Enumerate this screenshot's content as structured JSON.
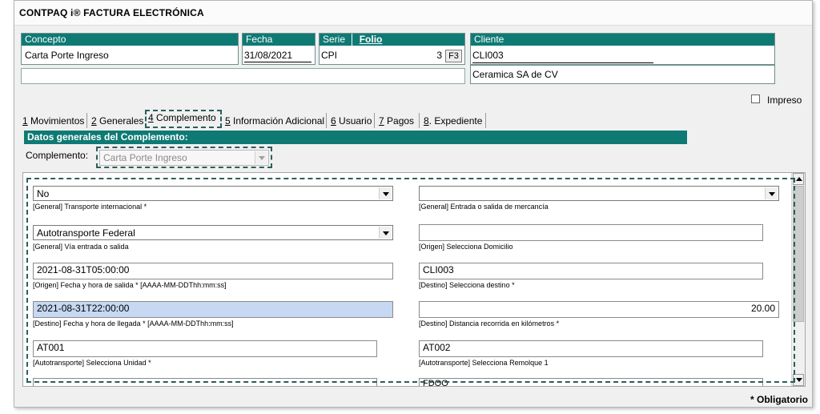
{
  "window": {
    "title": "CONTPAQ i® FACTURA ELECTRÓNICA"
  },
  "header": {
    "concepto": {
      "label": "Concepto",
      "value": "Carta Porte Ingreso"
    },
    "fecha": {
      "label": "Fecha",
      "value": "31/08/2021"
    },
    "serie": {
      "label": "Serie",
      "value": "CPI"
    },
    "folio": {
      "label": "Folio",
      "value": "3",
      "button": "F3"
    },
    "cliente": {
      "label": "Cliente",
      "code": "CLI003",
      "name": "Ceramica SA de CV"
    },
    "impreso_label": "Impreso"
  },
  "tabs": [
    {
      "num": "1",
      "label": " Movimientos"
    },
    {
      "num": "2",
      "label": " Generales"
    },
    {
      "num": "4",
      "label": " Complemento"
    },
    {
      "num": "5",
      "label": " Información Adicional"
    },
    {
      "num": "6",
      "label": " Usuario"
    },
    {
      "num": "7",
      "label": " Pagos"
    },
    {
      "num": "8",
      "label": ". Expediente"
    }
  ],
  "section": {
    "title": "Datos generales del Complemento:",
    "complemento_label": "Complemento:",
    "complemento_value": "Carta Porte Ingreso"
  },
  "form": {
    "transporte_internacional": {
      "value": "No",
      "label": "[General] Transporte internacional *"
    },
    "entrada_salida": {
      "value": "",
      "label": "[General] Entrada o salida de mercancía"
    },
    "via_entrada": {
      "value": "Autotransporte Federal",
      "label": "[General] Vía entrada o salida"
    },
    "origen_domicilio": {
      "value": "",
      "label": "[Origen] Selecciona Domicilio"
    },
    "origen_fecha": {
      "value": "2021-08-31T05:00:00",
      "label": "[Origen] Fecha y hora de salida * [AAAA-MM-DDThh:mm:ss]"
    },
    "destino": {
      "value": "CLI003",
      "label": "[Destino] Selecciona destino *"
    },
    "destino_fecha": {
      "value": "2021-08-31T22:00:00",
      "label": "[Destino] Fecha y hora de llegada * [AAAA-MM-DDThh:mm:ss]"
    },
    "distancia": {
      "value": "20.00",
      "label": "[Destino] Distancia recorrida en kilómetros *"
    },
    "unidad": {
      "value": "AT001",
      "label": "[Autotransporte] Selecciona Unidad *"
    },
    "remolque": {
      "value": "AT002",
      "label": "[Autotransporte] Selecciona Remolque 1"
    },
    "remolque2_partial": "FDOO"
  },
  "footer": {
    "obligatorio": "* Obligatorio"
  },
  "colors": {
    "accent": "#0f7a74",
    "highlight": "#c6d8f2",
    "dash": "#2b5f5a"
  }
}
